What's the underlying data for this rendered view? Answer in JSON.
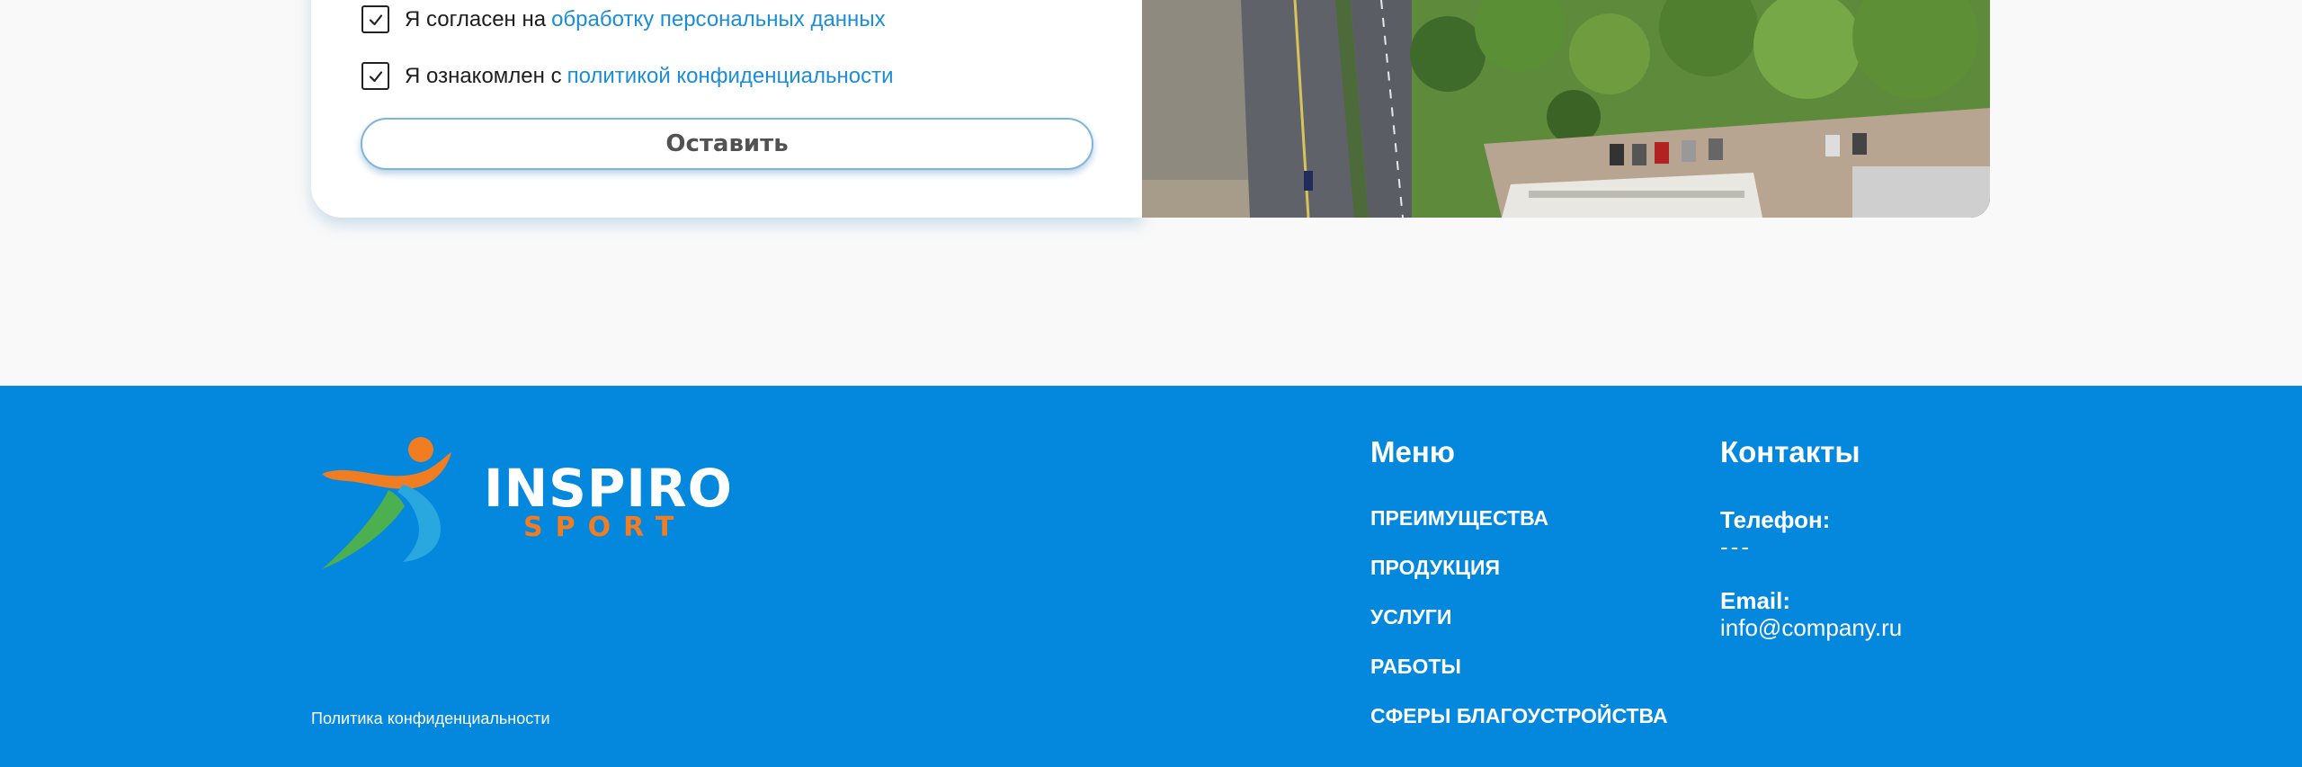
{
  "form": {
    "consent_text": "Я согласен на",
    "consent_link": "обработку персональных данных",
    "privacy_text": "Я ознакомлен с",
    "privacy_link": "политикой конфиденциальности",
    "consent_checked": true,
    "privacy_checked": true,
    "submit_label": "Оставить"
  },
  "logo": {
    "main": "INSPIRO",
    "sub": "SPORT",
    "colors": {
      "orange": "#f07d22",
      "green": "#4caf50",
      "blue": "#29a8e0"
    }
  },
  "footer": {
    "policy_link": "Политика конфиденциальности",
    "menu_title": "Меню",
    "menu_items": [
      {
        "label": "ПРЕИМУЩЕСТВА"
      },
      {
        "label": "ПРОДУКЦИЯ"
      },
      {
        "label": "УСЛУГИ"
      },
      {
        "label": "РАБОТЫ"
      },
      {
        "label": "СФЕРЫ БЛАГОУСТРОЙСТВА"
      }
    ],
    "contacts_title": "Контакты",
    "phone_label": "Телефон:",
    "phone_value": "---",
    "email_label": "Email:",
    "email_value": "info@company.ru"
  },
  "colors": {
    "footer_bg": "#0388de",
    "link": "#1a8ed6",
    "page_bg": "#f9f9f9"
  }
}
